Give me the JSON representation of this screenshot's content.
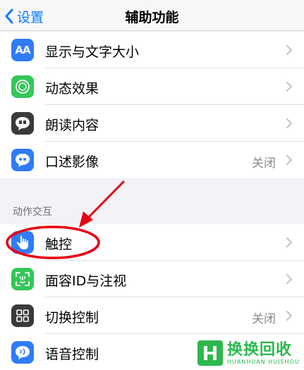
{
  "nav": {
    "back_label": "设置",
    "title": "辅助功能"
  },
  "vision_group": {
    "items": [
      {
        "label": "显示与文字大小",
        "value": "",
        "icon": "text-size-icon",
        "icon_glyph": "AA",
        "color": "#2f7cf6"
      },
      {
        "label": "动态效果",
        "value": "",
        "icon": "motion-icon",
        "icon_glyph": "",
        "color": "#34c759"
      },
      {
        "label": "朗读内容",
        "value": "",
        "icon": "spoken-content-icon",
        "icon_glyph": "",
        "color": "#3a3a3c"
      },
      {
        "label": "口述影像",
        "value": "关闭",
        "icon": "audio-description-icon",
        "icon_glyph": "",
        "color": "#2f7cf6"
      }
    ]
  },
  "interaction_group": {
    "header": "动作交互",
    "items": [
      {
        "label": "触控",
        "value": "",
        "icon": "touch-hand-icon",
        "color": "#2f7cf6"
      },
      {
        "label": "面容ID与注视",
        "value": "",
        "icon": "face-id-icon",
        "color": "#34c759"
      },
      {
        "label": "切换控制",
        "value": "关闭",
        "icon": "switch-control-icon",
        "color": "#3a3a3c"
      },
      {
        "label": "语音控制",
        "value": "",
        "icon": "voice-control-icon",
        "color": "#2f7cf6"
      }
    ]
  },
  "watermark": {
    "cn": "换换回收",
    "en": "HUANHUAN HUISHOU"
  },
  "colors": {
    "accent": "#0a7bff",
    "annotation": "#e60012"
  }
}
